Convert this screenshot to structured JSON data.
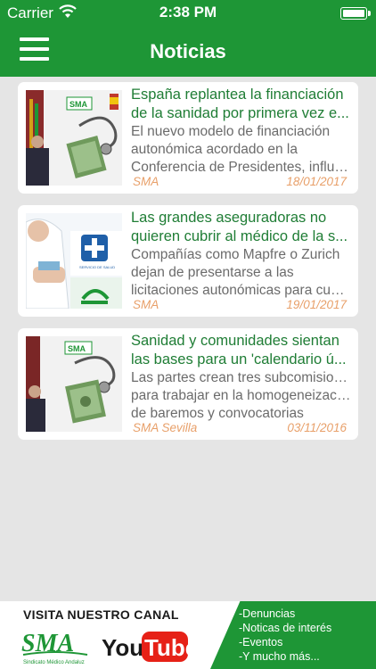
{
  "status_bar": {
    "carrier": "Carrier",
    "time": "2:38 PM"
  },
  "nav": {
    "title": "Noticias",
    "menu_icon": "hamburger-menu-icon"
  },
  "colors": {
    "brand_green": "#1e9636",
    "title_green": "#1f7d35",
    "meta_orange": "#e8a06a",
    "background": "#e5e5e5"
  },
  "news": [
    {
      "title_lines": [
        "España replantea la financiación",
        "de la sanidad por primera vez e..."
      ],
      "summary_lines": [
        "El nuevo modelo de financiación",
        "autonómica acordado en la",
        "Conferencia de Presidentes, influir..."
      ],
      "source": "SMA",
      "date": "18/01/2017"
    },
    {
      "title_lines": [
        "Las grandes aseguradoras no",
        "quieren cubrir al médico de la s..."
      ],
      "summary_lines": [
        "Compañías como Mapfre o Zurich",
        "dejan de presentarse a las",
        "licitaciones autonómicas para cubr..."
      ],
      "source": "SMA",
      "date": "19/01/2017"
    },
    {
      "title_lines": [
        "Sanidad y comunidades sientan",
        "las bases para un 'calendario ú..."
      ],
      "summary_lines": [
        "Las partes crean tres subcomisiones",
        "para trabajar en la homogeneización",
        "de baremos y convocatorias"
      ],
      "source": "SMA Sevilla",
      "date": "03/11/2016"
    }
  ],
  "banner": {
    "heading": "VISITA NUESTRO CANAL",
    "sma_text": "SMA",
    "sma_subtext": "Sindicato Médico Andaluz",
    "youtube_you": "You",
    "youtube_tube": "Tube",
    "items": [
      "-Denuncias",
      "-Noticas de interés",
      "-Eventos",
      "-Y mucho más..."
    ]
  }
}
